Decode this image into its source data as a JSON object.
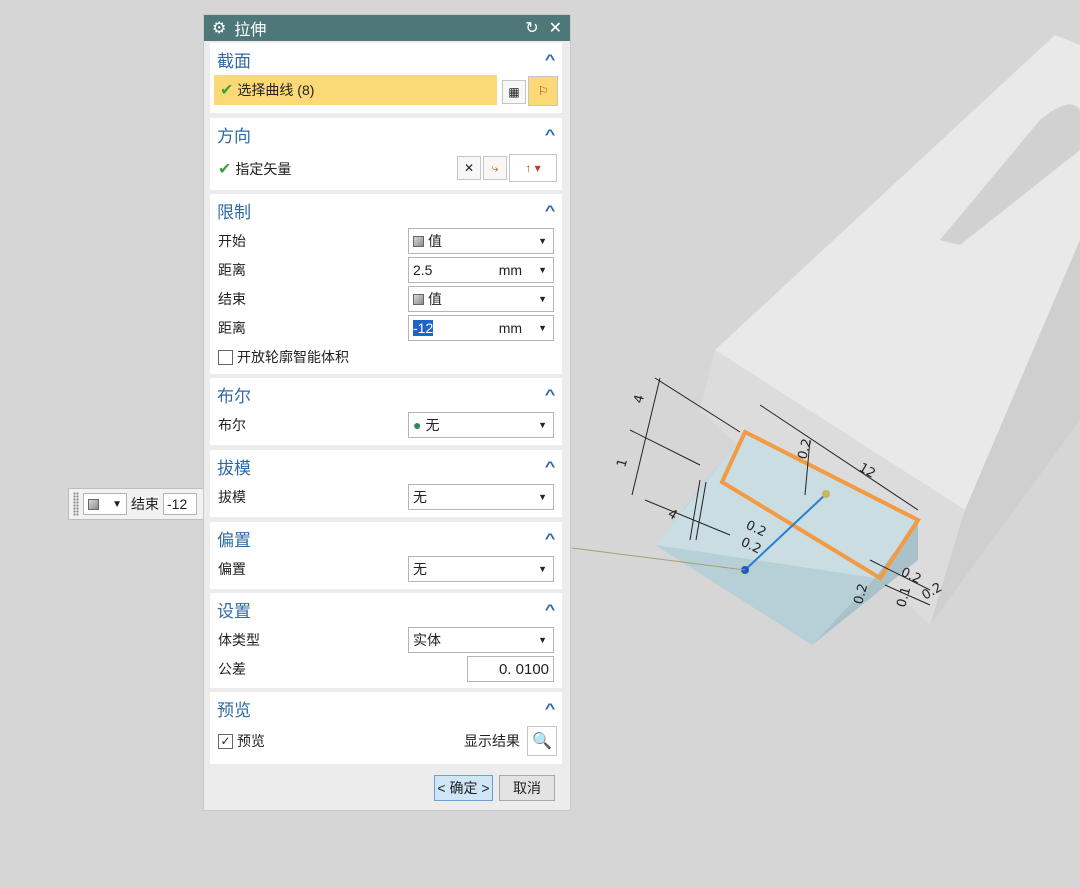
{
  "dialog": {
    "title": "拉伸",
    "sections": {
      "section": {
        "title": "截面",
        "select_curve": "选择曲线 (8)"
      },
      "direction": {
        "title": "方向",
        "vector_label": "指定矢量"
      },
      "limits": {
        "title": "限制",
        "start_label": "开始",
        "start_value": "值",
        "distance1_label": "距离",
        "distance1_value": "2.5",
        "distance1_unit": "mm",
        "end_label": "结束",
        "end_value": "值",
        "distance2_label": "距离",
        "distance2_value": "-12",
        "distance2_unit": "mm",
        "open_profile_label": "开放轮廓智能体积"
      },
      "boolean": {
        "title": "布尔",
        "label": "布尔",
        "value": "无"
      },
      "draft": {
        "title": "拔模",
        "label": "拔模",
        "value": "无"
      },
      "offset": {
        "title": "偏置",
        "label": "偏置",
        "value": "无"
      },
      "settings": {
        "title": "设置",
        "body_type_label": "体类型",
        "body_type_value": "实体",
        "tolerance_label": "公差",
        "tolerance_value": "0. 0100"
      },
      "preview": {
        "title": "预览",
        "preview_label": "预览",
        "show_result_label": "显示结果"
      }
    },
    "buttons": {
      "ok": "< 确定 >",
      "cancel": "取消"
    }
  },
  "mini_toolbar": {
    "end_label": "结束",
    "end_value": "-12"
  },
  "viewport": {
    "dimensions": [
      "4",
      "1",
      "4",
      "0.2",
      "12",
      "0.2",
      "0.2",
      "0.2",
      "0.2",
      "0.2",
      "0.1"
    ]
  },
  "colors": {
    "title_bar": "#4d7779",
    "section_title": "#2f6aa6",
    "highlight": "#fcd977",
    "sketch_outline": "#f39a43",
    "solid_face": "#c9dde3"
  }
}
